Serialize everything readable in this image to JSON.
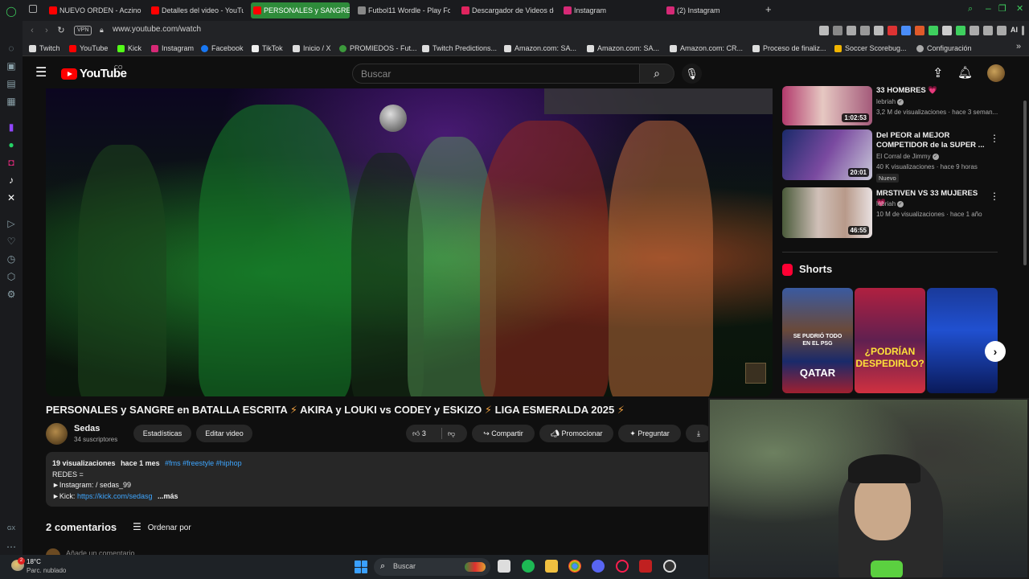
{
  "browser": {
    "tabs": [
      {
        "label": "NUEVO ORDEN - Aczino v",
        "color": "#ff0000"
      },
      {
        "label": "Detalles del video - YouTu",
        "color": "#ff0000"
      },
      {
        "label": "PERSONALES y SANGRE",
        "color": "#ff0000",
        "active": true
      },
      {
        "label": "Futbol11 Wordle - Play Foo",
        "color": "#888888"
      },
      {
        "label": "Descargador de Videos de",
        "color": "#e0245e"
      },
      {
        "label": "Instagram",
        "color": "#d62976"
      },
      {
        "label": "(2) Instagram",
        "color": "#d62976"
      }
    ],
    "url": "www.youtube.com/watch",
    "vpn_label": "VPN",
    "ai_label": "AI",
    "bookmarks": [
      {
        "label": "Twitch",
        "icon": "page-icon"
      },
      {
        "label": "YouTube",
        "icon": "youtube-icon"
      },
      {
        "label": "Kick",
        "icon": "kick-icon"
      },
      {
        "label": "Instagram",
        "icon": "instagram-icon"
      },
      {
        "label": "Facebook",
        "icon": "facebook-icon"
      },
      {
        "label": "TikTok",
        "icon": "tiktok-icon"
      },
      {
        "label": "Inicio / X",
        "icon": "x-icon"
      },
      {
        "label": "PROMIEDOS - Fut...",
        "icon": "promiedos-icon"
      },
      {
        "label": "Twitch Predictions...",
        "icon": "page-icon"
      },
      {
        "label": "Amazon.com: SA...",
        "icon": "amazon-icon"
      },
      {
        "label": "Amazon.com: SA...",
        "icon": "amazon-icon"
      },
      {
        "label": "Amazon.com: CR...",
        "icon": "amazon-icon"
      },
      {
        "label": "Proceso de finaliz...",
        "icon": "page-icon"
      },
      {
        "label": "Soccer Scorebug...",
        "icon": "scorebug-icon"
      },
      {
        "label": "Configuración",
        "icon": "gear-icon"
      }
    ]
  },
  "youtube": {
    "logo_text": "YouTube",
    "country_code": "CO",
    "search_placeholder": "Buscar",
    "video": {
      "title_part1": "PERSONALES y SANGRE en BATALLA ESCRITA",
      "title_part2": "AKIRA y LOUKI vs CODEY y ESKIZO",
      "title_part3": "LIGA ESMERALDA 2025",
      "bolt": "⚡",
      "channel": "Sedas",
      "subscribers": "34 suscriptores",
      "stats_label": "Estadísticas",
      "edit_label": "Editar video",
      "likes": "3",
      "share_label": "Compartir",
      "promote_label": "Promocionar",
      "ask_label": "Preguntar",
      "views": "19 visualizaciones",
      "published": "hace 1 mes",
      "tags": "#fms #freestyle #hiphop",
      "desc_line1": "REDES =",
      "desc_line2_prefix": "►Instagram:",
      "desc_line2_value": "/ sedas_99",
      "desc_line3_prefix": "►Kick:",
      "desc_line3_link": "https://kick.com/sedasg",
      "more_label": "...más",
      "comments_count": "2 comentarios",
      "sort_label": "Ordenar por",
      "comment_placeholder": "Añade un comentario..."
    },
    "recommendations": [
      {
        "title": "33 HOMBRES 💗",
        "channel": "lebriah",
        "meta": "3,2 M de visualizaciones · hace 3 seman...",
        "duration": "1:02:53"
      },
      {
        "title": "Del PEOR al MEJOR COMPETIDOR de la SUPER ...",
        "channel": "El Corral de Jimmy",
        "meta": "40 K visualizaciones · hace 9 horas",
        "duration": "20:01",
        "badge": "Nuevo"
      },
      {
        "title": "MRSTIVEN VS 33 MUJERES 💗",
        "channel": "lebriah",
        "meta": "10 M de visualizaciones · hace 1 año",
        "duration": "46:55"
      }
    ],
    "shorts_title": "Shorts",
    "shorts": [
      {
        "caption_top": "SE PUDRIÓ TODO EN EL PSG",
        "caption_bottom": "QATAR"
      },
      {
        "caption_top": "",
        "caption_bottom": "¿PODRÍAN DESPEDIRLO?"
      },
      {
        "caption_top": "",
        "caption_bottom": ""
      }
    ]
  },
  "taskbar": {
    "temperature": "18°C",
    "weather": "Parc. nublado",
    "weather_badge": "2",
    "search_label": "Buscar"
  }
}
